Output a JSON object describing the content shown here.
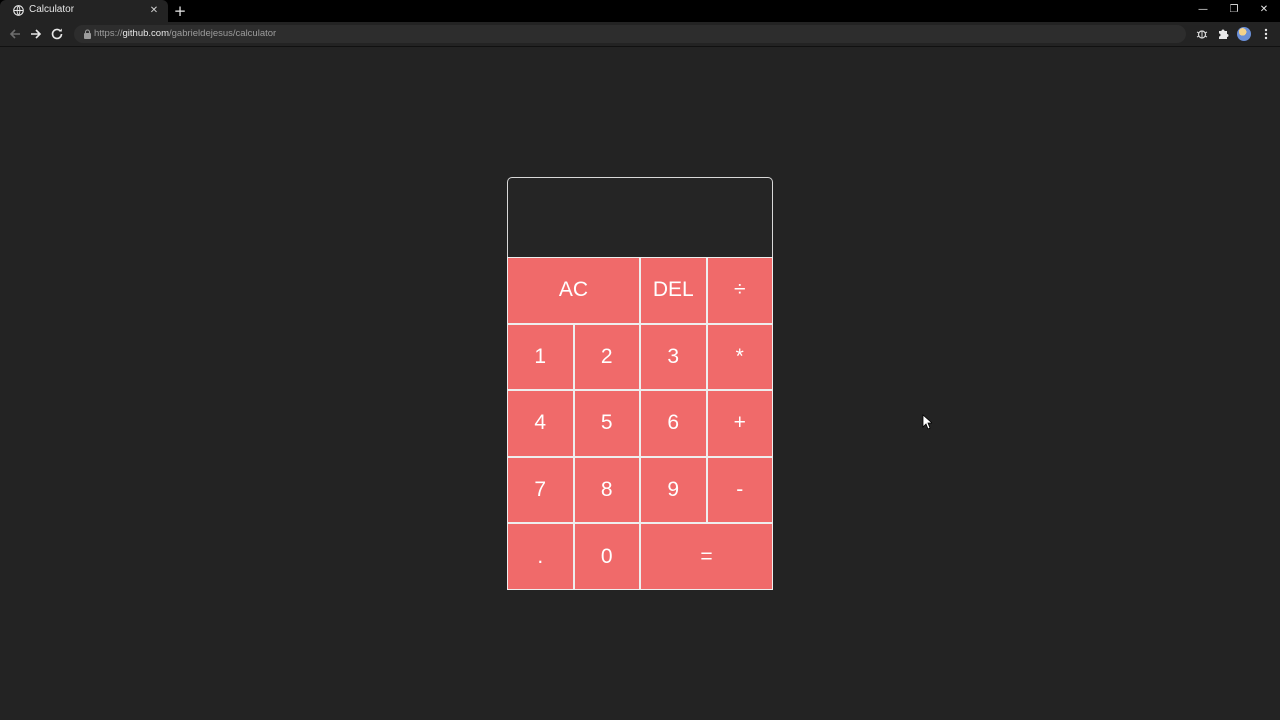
{
  "browser": {
    "tab": {
      "title": "Calculator",
      "close_glyph": "✕",
      "favicon": "globe-icon"
    },
    "new_tab_glyph": "+",
    "window_controls": {
      "minimize": "—",
      "maximize": "❐",
      "close": "✕"
    },
    "address_bar": {
      "scheme": "https://",
      "host": "github.com",
      "path": "/gabrieldejesus/calculator"
    }
  },
  "calculator": {
    "display": {
      "previous": "",
      "current": ""
    },
    "keys": [
      {
        "label": "AC",
        "role": "all-clear",
        "wide": true
      },
      {
        "label": "DEL",
        "role": "delete"
      },
      {
        "label": "÷",
        "role": "divide"
      },
      {
        "label": "1",
        "role": "digit-1"
      },
      {
        "label": "2",
        "role": "digit-2"
      },
      {
        "label": "3",
        "role": "digit-3"
      },
      {
        "label": "*",
        "role": "multiply"
      },
      {
        "label": "4",
        "role": "digit-4"
      },
      {
        "label": "5",
        "role": "digit-5"
      },
      {
        "label": "6",
        "role": "digit-6"
      },
      {
        "label": "+",
        "role": "add"
      },
      {
        "label": "7",
        "role": "digit-7"
      },
      {
        "label": "8",
        "role": "digit-8"
      },
      {
        "label": "9",
        "role": "digit-9"
      },
      {
        "label": "-",
        "role": "subtract"
      },
      {
        "label": ".",
        "role": "decimal"
      },
      {
        "label": "0",
        "role": "digit-0"
      },
      {
        "label": "=",
        "role": "equals",
        "wide": true
      }
    ],
    "colors": {
      "key": "#f06a6a",
      "key_text": "#ffffff",
      "display_bg": "#252525",
      "page_bg": "#232323"
    }
  }
}
